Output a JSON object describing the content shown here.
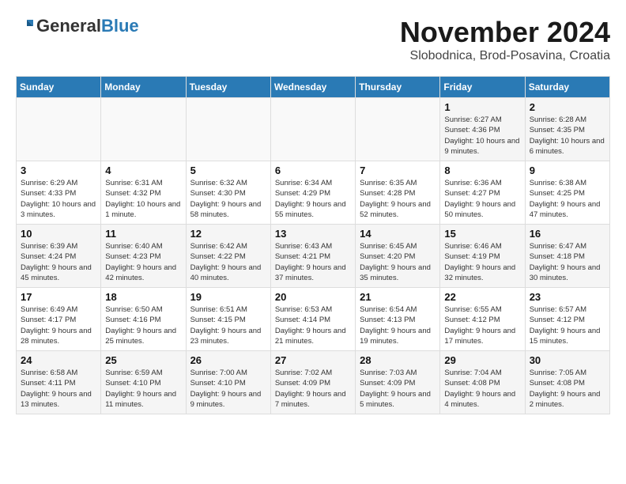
{
  "logo": {
    "general": "General",
    "blue": "Blue"
  },
  "header": {
    "month_year": "November 2024",
    "location": "Slobodnica, Brod-Posavina, Croatia"
  },
  "columns": [
    "Sunday",
    "Monday",
    "Tuesday",
    "Wednesday",
    "Thursday",
    "Friday",
    "Saturday"
  ],
  "weeks": [
    [
      {
        "day": "",
        "info": ""
      },
      {
        "day": "",
        "info": ""
      },
      {
        "day": "",
        "info": ""
      },
      {
        "day": "",
        "info": ""
      },
      {
        "day": "",
        "info": ""
      },
      {
        "day": "1",
        "info": "Sunrise: 6:27 AM\nSunset: 4:36 PM\nDaylight: 10 hours and 9 minutes."
      },
      {
        "day": "2",
        "info": "Sunrise: 6:28 AM\nSunset: 4:35 PM\nDaylight: 10 hours and 6 minutes."
      }
    ],
    [
      {
        "day": "3",
        "info": "Sunrise: 6:29 AM\nSunset: 4:33 PM\nDaylight: 10 hours and 3 minutes."
      },
      {
        "day": "4",
        "info": "Sunrise: 6:31 AM\nSunset: 4:32 PM\nDaylight: 10 hours and 1 minute."
      },
      {
        "day": "5",
        "info": "Sunrise: 6:32 AM\nSunset: 4:30 PM\nDaylight: 9 hours and 58 minutes."
      },
      {
        "day": "6",
        "info": "Sunrise: 6:34 AM\nSunset: 4:29 PM\nDaylight: 9 hours and 55 minutes."
      },
      {
        "day": "7",
        "info": "Sunrise: 6:35 AM\nSunset: 4:28 PM\nDaylight: 9 hours and 52 minutes."
      },
      {
        "day": "8",
        "info": "Sunrise: 6:36 AM\nSunset: 4:27 PM\nDaylight: 9 hours and 50 minutes."
      },
      {
        "day": "9",
        "info": "Sunrise: 6:38 AM\nSunset: 4:25 PM\nDaylight: 9 hours and 47 minutes."
      }
    ],
    [
      {
        "day": "10",
        "info": "Sunrise: 6:39 AM\nSunset: 4:24 PM\nDaylight: 9 hours and 45 minutes."
      },
      {
        "day": "11",
        "info": "Sunrise: 6:40 AM\nSunset: 4:23 PM\nDaylight: 9 hours and 42 minutes."
      },
      {
        "day": "12",
        "info": "Sunrise: 6:42 AM\nSunset: 4:22 PM\nDaylight: 9 hours and 40 minutes."
      },
      {
        "day": "13",
        "info": "Sunrise: 6:43 AM\nSunset: 4:21 PM\nDaylight: 9 hours and 37 minutes."
      },
      {
        "day": "14",
        "info": "Sunrise: 6:45 AM\nSunset: 4:20 PM\nDaylight: 9 hours and 35 minutes."
      },
      {
        "day": "15",
        "info": "Sunrise: 6:46 AM\nSunset: 4:19 PM\nDaylight: 9 hours and 32 minutes."
      },
      {
        "day": "16",
        "info": "Sunrise: 6:47 AM\nSunset: 4:18 PM\nDaylight: 9 hours and 30 minutes."
      }
    ],
    [
      {
        "day": "17",
        "info": "Sunrise: 6:49 AM\nSunset: 4:17 PM\nDaylight: 9 hours and 28 minutes."
      },
      {
        "day": "18",
        "info": "Sunrise: 6:50 AM\nSunset: 4:16 PM\nDaylight: 9 hours and 25 minutes."
      },
      {
        "day": "19",
        "info": "Sunrise: 6:51 AM\nSunset: 4:15 PM\nDaylight: 9 hours and 23 minutes."
      },
      {
        "day": "20",
        "info": "Sunrise: 6:53 AM\nSunset: 4:14 PM\nDaylight: 9 hours and 21 minutes."
      },
      {
        "day": "21",
        "info": "Sunrise: 6:54 AM\nSunset: 4:13 PM\nDaylight: 9 hours and 19 minutes."
      },
      {
        "day": "22",
        "info": "Sunrise: 6:55 AM\nSunset: 4:12 PM\nDaylight: 9 hours and 17 minutes."
      },
      {
        "day": "23",
        "info": "Sunrise: 6:57 AM\nSunset: 4:12 PM\nDaylight: 9 hours and 15 minutes."
      }
    ],
    [
      {
        "day": "24",
        "info": "Sunrise: 6:58 AM\nSunset: 4:11 PM\nDaylight: 9 hours and 13 minutes."
      },
      {
        "day": "25",
        "info": "Sunrise: 6:59 AM\nSunset: 4:10 PM\nDaylight: 9 hours and 11 minutes."
      },
      {
        "day": "26",
        "info": "Sunrise: 7:00 AM\nSunset: 4:10 PM\nDaylight: 9 hours and 9 minutes."
      },
      {
        "day": "27",
        "info": "Sunrise: 7:02 AM\nSunset: 4:09 PM\nDaylight: 9 hours and 7 minutes."
      },
      {
        "day": "28",
        "info": "Sunrise: 7:03 AM\nSunset: 4:09 PM\nDaylight: 9 hours and 5 minutes."
      },
      {
        "day": "29",
        "info": "Sunrise: 7:04 AM\nSunset: 4:08 PM\nDaylight: 9 hours and 4 minutes."
      },
      {
        "day": "30",
        "info": "Sunrise: 7:05 AM\nSunset: 4:08 PM\nDaylight: 9 hours and 2 minutes."
      }
    ]
  ]
}
